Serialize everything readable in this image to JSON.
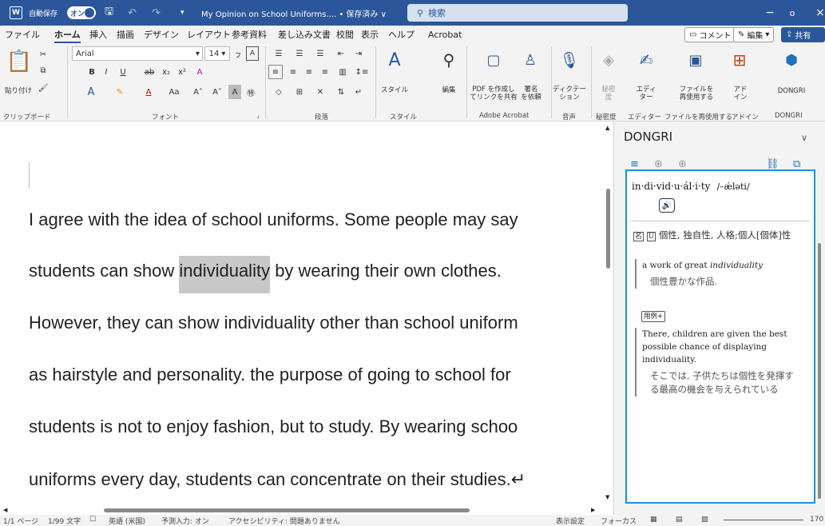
{
  "titlebar": {
    "autosave_label": "自動保存",
    "autosave_state": "オン",
    "doc_title": "My Opinion on School Uniforms.... • 保存済み ∨",
    "search_placeholder": "検索",
    "minimize": "−",
    "restore": "o",
    "close": "×"
  },
  "menubar": {
    "items": [
      "ファイル",
      "ホーム",
      "挿入",
      "描画",
      "デザイン",
      "レイアウト",
      "参考資料",
      "差し込み文書",
      "校閲",
      "表示",
      "ヘルプ",
      "Acrobat"
    ],
    "active_index": 1,
    "comment_button": "コメント",
    "edit_button": "編集",
    "share_button": "共有"
  },
  "ribbon": {
    "clipboard": {
      "paste": "貼り付け",
      "group": "クリップボード"
    },
    "font": {
      "name": "Arial",
      "size": "14",
      "group": "フォント"
    },
    "paragraph": {
      "group": "段落"
    },
    "styles": {
      "label": "スタイル",
      "edit": "編集",
      "group": "スタイル"
    },
    "acrobat": {
      "pdf_share": "PDF を作成し\nてリンクを共有",
      "sign": "署名\nを依頼",
      "group": "Adobe Acrobat"
    },
    "voice": {
      "dictate": "ディクテー\nション",
      "group": "音声"
    },
    "sensitivity": {
      "label": "秘密\n度",
      "group": "秘密度"
    },
    "editor": {
      "label": "エディ\nター",
      "group": "エディター"
    },
    "reuse": {
      "label": "ファイルを\n再使用する",
      "group": "ファイルを再使用する"
    },
    "addins": {
      "label": "アド\nイン",
      "group": "アドイン"
    },
    "dongri": {
      "label": "DONGRI",
      "group": "DONGRI"
    }
  },
  "document": {
    "lines": [
      {
        "text": "I agree with the idea of school uniforms. Some people may say"
      },
      {
        "before": "students can show ",
        "highlight": "individuality",
        "after": " by wearing their own clothes."
      },
      {
        "text": "However, they can show individuality other than school uniform"
      },
      {
        "text": "as hairstyle and personality. the purpose of going to school for"
      },
      {
        "text": "students is not to enjoy fashion, but to study. By wearing schoo"
      },
      {
        "text": "uniforms every day, students can concentrate on their studies.↵"
      }
    ]
  },
  "pane": {
    "title": "DONGRI",
    "headword": "in·di·vid·u·ál·i·ty",
    "pronunciation": "/–ǽləti/",
    "sense_pos": "名",
    "sense_u": "U",
    "sense_text": "個性, 独自性, 人格;個人[個体]性",
    "example1_en_prefix": "a work of great ",
    "example1_en_em": "individuality",
    "example1_ja": "個性豊かな作品.",
    "example_tag": "用例+",
    "example2_en": "There, children are given the best possible chance of displaying individuality.",
    "example2_ja": "そこでは, 子供たちは個性を発揮する最高の機会を与えられている"
  },
  "status": {
    "page": "1/1 ページ",
    "words": "1/99 文字",
    "lang": "英語 (米国)",
    "predict": "予測入力: オン",
    "accessibility": "アクセシビリティ: 問題ありません",
    "display": "表示設定",
    "focus": "フォーカス",
    "zoom": "170"
  },
  "colors": {
    "title_bg": "#2b579a",
    "pane_border": "#1e90d6",
    "highlight": "#c8c8c8"
  }
}
